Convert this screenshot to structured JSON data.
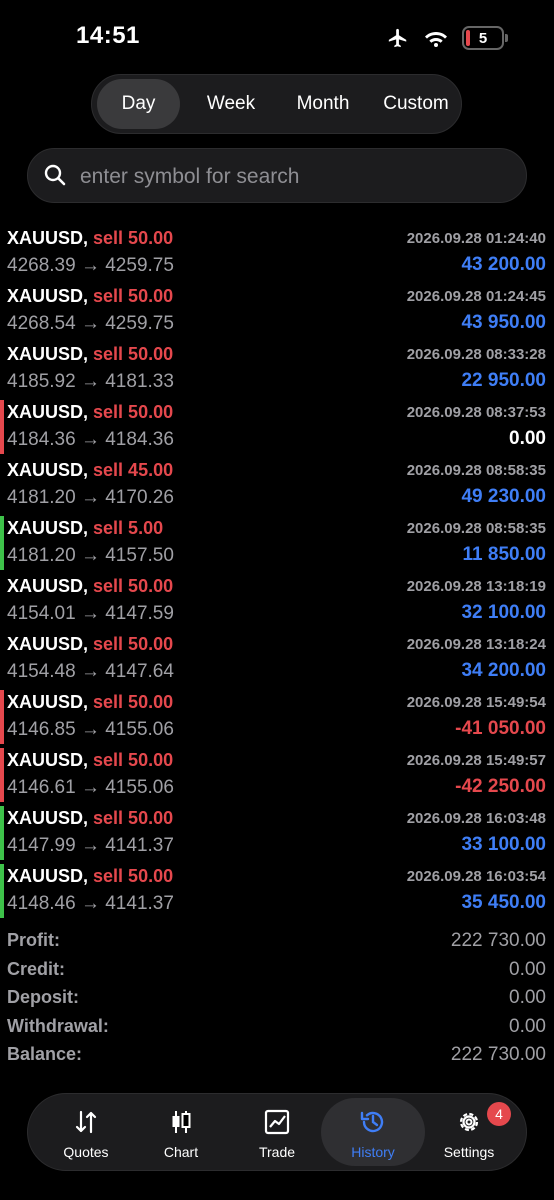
{
  "status_bar": {
    "time": "14:51",
    "battery": "5"
  },
  "segments": [
    "Day",
    "Week",
    "Month",
    "Custom"
  ],
  "active_segment": "Day",
  "search": {
    "placeholder": "enter symbol for search"
  },
  "trades": [
    {
      "symbol": "XAUUSD,",
      "side": "sell 50.00",
      "datetime": "2026.09.28 01:24:40",
      "prices": "4268.39 → 4259.75",
      "profit": "43 200.00",
      "profit_type": "pos",
      "bar": "none"
    },
    {
      "symbol": "XAUUSD,",
      "side": "sell 50.00",
      "datetime": "2026.09.28 01:24:45",
      "prices": "4268.54 → 4259.75",
      "profit": "43 950.00",
      "profit_type": "pos",
      "bar": "none"
    },
    {
      "symbol": "XAUUSD,",
      "side": "sell 50.00",
      "datetime": "2026.09.28 08:33:28",
      "prices": "4185.92 → 4181.33",
      "profit": "22 950.00",
      "profit_type": "pos",
      "bar": "none"
    },
    {
      "symbol": "XAUUSD,",
      "side": "sell 50.00",
      "datetime": "2026.09.28 08:37:53",
      "prices": "4184.36 → 4184.36",
      "profit": "0.00",
      "profit_type": "zero",
      "bar": "red"
    },
    {
      "symbol": "XAUUSD,",
      "side": "sell 45.00",
      "datetime": "2026.09.28 08:58:35",
      "prices": "4181.20 → 4170.26",
      "profit": "49 230.00",
      "profit_type": "pos",
      "bar": "none"
    },
    {
      "symbol": "XAUUSD,",
      "side": "sell 5.00",
      "datetime": "2026.09.28 08:58:35",
      "prices": "4181.20 → 4157.50",
      "profit": "11 850.00",
      "profit_type": "pos",
      "bar": "green"
    },
    {
      "symbol": "XAUUSD,",
      "side": "sell 50.00",
      "datetime": "2026.09.28 13:18:19",
      "prices": "4154.01 → 4147.59",
      "profit": "32 100.00",
      "profit_type": "pos",
      "bar": "none"
    },
    {
      "symbol": "XAUUSD,",
      "side": "sell 50.00",
      "datetime": "2026.09.28 13:18:24",
      "prices": "4154.48 → 4147.64",
      "profit": "34 200.00",
      "profit_type": "pos",
      "bar": "none"
    },
    {
      "symbol": "XAUUSD,",
      "side": "sell 50.00",
      "datetime": "2026.09.28 15:49:54",
      "prices": "4146.85 → 4155.06",
      "profit": "-41 050.00",
      "profit_type": "neg",
      "bar": "red"
    },
    {
      "symbol": "XAUUSD,",
      "side": "sell 50.00",
      "datetime": "2026.09.28 15:49:57",
      "prices": "4146.61 → 4155.06",
      "profit": "-42 250.00",
      "profit_type": "neg",
      "bar": "red"
    },
    {
      "symbol": "XAUUSD,",
      "side": "sell 50.00",
      "datetime": "2026.09.28 16:03:48",
      "prices": "4147.99 → 4141.37",
      "profit": "33 100.00",
      "profit_type": "pos",
      "bar": "green"
    },
    {
      "symbol": "XAUUSD,",
      "side": "sell 50.00",
      "datetime": "2026.09.28 16:03:54",
      "prices": "4148.46 → 4141.37",
      "profit": "35 450.00",
      "profit_type": "pos",
      "bar": "green"
    }
  ],
  "summary": [
    {
      "label": "Profit:",
      "value": "222 730.00"
    },
    {
      "label": "Credit:",
      "value": "0.00"
    },
    {
      "label": "Deposit:",
      "value": "0.00"
    },
    {
      "label": "Withdrawal:",
      "value": "0.00"
    },
    {
      "label": "Balance:",
      "value": "222 730.00"
    }
  ],
  "tabs": [
    {
      "label": "Quotes",
      "icon": "quotes-icon"
    },
    {
      "label": "Chart",
      "icon": "chart-icon"
    },
    {
      "label": "Trade",
      "icon": "trade-icon"
    },
    {
      "label": "History",
      "icon": "history-icon"
    },
    {
      "label": "Settings",
      "icon": "settings-icon",
      "badge": "4"
    }
  ],
  "active_tab": "History",
  "colors": {
    "accent": "#3f7ef6",
    "negative": "#e5484d",
    "positive_bar": "#3ec24a",
    "background": "#000000"
  }
}
